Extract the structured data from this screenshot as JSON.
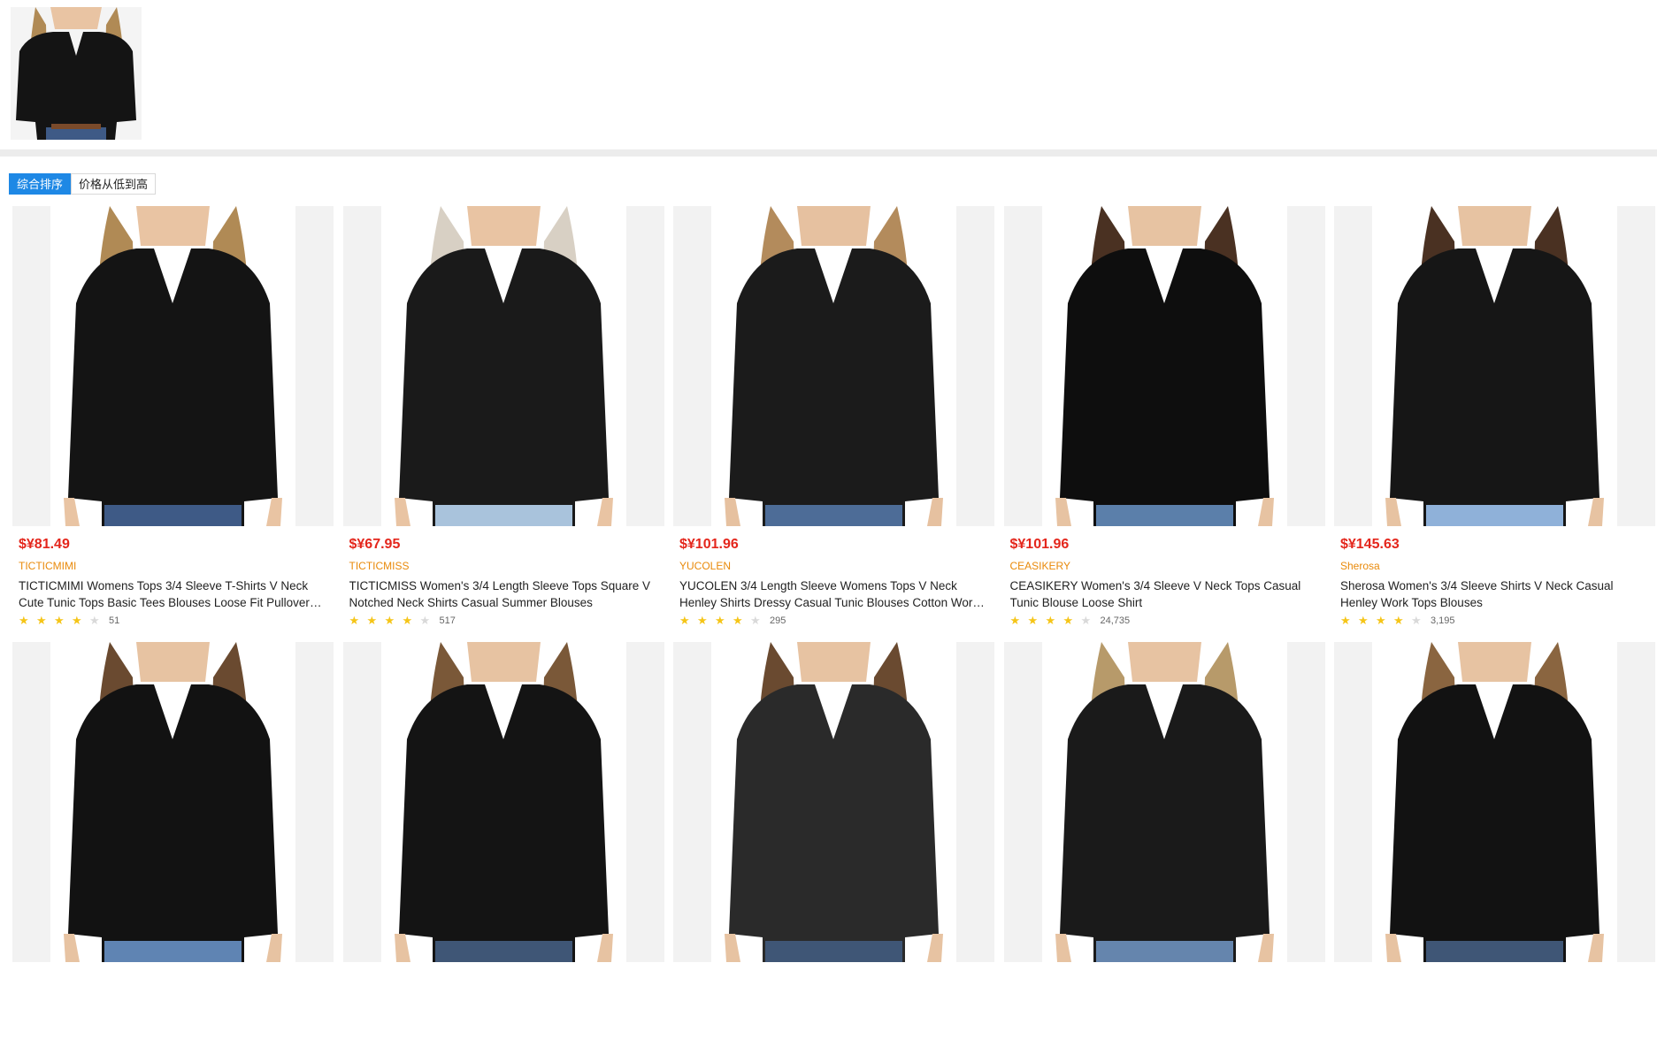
{
  "sort": {
    "tabs": [
      {
        "label": "综合排序",
        "active": true
      },
      {
        "label": "价格从低到高",
        "active": false
      }
    ]
  },
  "colors": {
    "price": "#e4261c",
    "brand": "#e98a0b",
    "accent": "#1e88e5",
    "star": "#f5c518"
  },
  "products": [
    {
      "price": "$¥81.49",
      "brand": "TICTICMIMI",
      "title": "TICTICMIMI Womens Tops 3/4 Sleeve T-Shirts V Neck Cute Tunic Tops Basic Tees Blouses Loose Fit Pullover Summ…",
      "stars": 4,
      "reviews": "51",
      "hair": "#b08a55",
      "skin": "#e9c4a3",
      "shirt": "#141414",
      "pants": "#3e5a86"
    },
    {
      "price": "$¥67.95",
      "brand": "TICTICMISS",
      "title": "TICTICMISS Women's 3/4 Length Sleeve Tops Square V Notched Neck Shirts Casual Summer Blouses",
      "stars": 4,
      "reviews": "517",
      "hair": "#d8d0c4",
      "skin": "#e9c4a3",
      "shirt": "#1a1a1a",
      "pants": "#a9c3dc"
    },
    {
      "price": "$¥101.96",
      "brand": "YUCOLEN",
      "title": "YUCOLEN 3/4 Length Sleeve Womens Tops V Neck Henley Shirts Dressy Casual Tunic Blouses Cotton Work Summe…",
      "stars": 4,
      "reviews": "295",
      "hair": "#b38b5c",
      "skin": "#e6c1a0",
      "shirt": "#1b1b1b",
      "pants": "#4d6c97"
    },
    {
      "price": "$¥101.96",
      "brand": "CEASIKERY",
      "title": "CEASIKERY Women's 3/4 Sleeve V Neck Tops Casual Tunic Blouse Loose Shirt",
      "stars": 4,
      "reviews": "24,735",
      "hair": "#4a3122",
      "skin": "#e7c3a2",
      "shirt": "#0e0e0e",
      "pants": "#5b7faa"
    },
    {
      "price": "$¥145.63",
      "brand": "Sherosa",
      "title": "Sherosa Women's 3/4 Sleeve Shirts V Neck Casual Henley Work Tops Blouses",
      "stars": 4,
      "reviews": "3,195",
      "hair": "#4a3122",
      "skin": "#e7c3a2",
      "shirt": "#161616",
      "pants": "#8fb1d9"
    },
    {
      "price": "",
      "brand": "",
      "title": "",
      "stars": 0,
      "reviews": "",
      "hair": "#6a4a30",
      "skin": "#e7c3a2",
      "shirt": "#121212",
      "pants": "#5f84b3"
    },
    {
      "price": "",
      "brand": "",
      "title": "",
      "stars": 0,
      "reviews": "",
      "hair": "#7a5838",
      "skin": "#e7c3a2",
      "shirt": "#141414",
      "pants": "#3f5676"
    },
    {
      "price": "",
      "brand": "",
      "title": "",
      "stars": 0,
      "reviews": "",
      "hair": "#6a4a30",
      "skin": "#e7c3a2",
      "shirt": "#2a2a2a",
      "pants": "#3f5676"
    },
    {
      "price": "",
      "brand": "",
      "title": "",
      "stars": 0,
      "reviews": "",
      "hair": "#b79a6a",
      "skin": "#e7c3a2",
      "shirt": "#1a1a1a",
      "pants": "#6585ad"
    },
    {
      "price": "",
      "brand": "",
      "title": "",
      "stars": 0,
      "reviews": "",
      "hair": "#8a6540",
      "skin": "#e7c3a2",
      "shirt": "#121212",
      "pants": "#3f5676"
    }
  ]
}
